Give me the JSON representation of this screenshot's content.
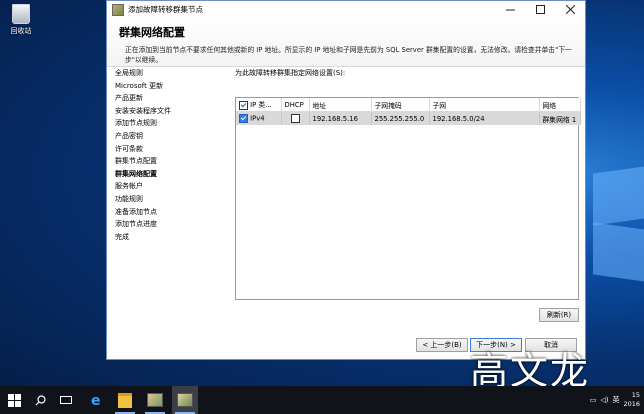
{
  "desktop": {
    "recycle_label": "回收站",
    "watermark": "高文龙"
  },
  "window": {
    "title": "添加故障转移群集节点",
    "page_title": "群集网络配置",
    "description": "正在添加到当前节点不要求任何其他或新的 IP 地址。所显示的 IP 地址和子网是先前为 SQL Server 群集配置的设置，无法修改。请检查并单击\"下一步\"以继续。",
    "nav": [
      "全局规则",
      "Microsoft 更新",
      "产品更新",
      "安装安装程序文件",
      "添加节点规则",
      "产品密钥",
      "许可条款",
      "群集节点配置",
      "群集网络配置",
      "服务帐户",
      "功能规则",
      "准备添加节点",
      "添加节点进度",
      "完成"
    ],
    "active_nav_index": 8,
    "prompt": "为此故障转移群集指定网络设置(S):",
    "grid": {
      "headers": [
        "IP 类...",
        "DHCP",
        "地址",
        "子网掩码",
        "子网",
        "网络"
      ],
      "rows": [
        {
          "checked": true,
          "ip_type": "IPv4",
          "dhcp": false,
          "address": "192.168.5.16",
          "mask": "255.255.255.0",
          "subnet": "192.168.5.0/24",
          "network": "群集网络 1"
        }
      ]
    },
    "refresh_label": "刷新(R)",
    "back_label": "< 上一步(B)",
    "next_label": "下一步(N) >",
    "cancel_label": "取消"
  },
  "taskbar": {
    "ime": "英",
    "time": "15",
    "date": "2016"
  }
}
